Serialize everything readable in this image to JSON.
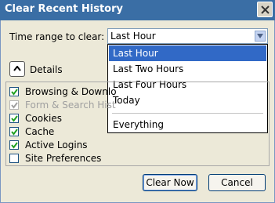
{
  "window": {
    "title": "Clear Recent History"
  },
  "time_range": {
    "label": "Time range to clear:",
    "selected": "Last Hour",
    "options": [
      "Last Hour",
      "Last Two Hours",
      "Last Four Hours",
      "Today",
      "Everything"
    ]
  },
  "details": {
    "label": "Details"
  },
  "items": [
    {
      "label": "Browsing & Downlo",
      "checked": true,
      "disabled": false
    },
    {
      "label": "Form & Search Hist",
      "checked": true,
      "disabled": true
    },
    {
      "label": "Cookies",
      "checked": true,
      "disabled": false
    },
    {
      "label": "Cache",
      "checked": true,
      "disabled": false
    },
    {
      "label": "Active Logins",
      "checked": true,
      "disabled": false
    },
    {
      "label": "Site Preferences",
      "checked": false,
      "disabled": false
    }
  ],
  "buttons": {
    "clear": "Clear Now",
    "cancel": "Cancel"
  },
  "colors": {
    "titlebar": "#3a6ea5",
    "selection": "#3169c6",
    "face": "#ece9d8"
  }
}
